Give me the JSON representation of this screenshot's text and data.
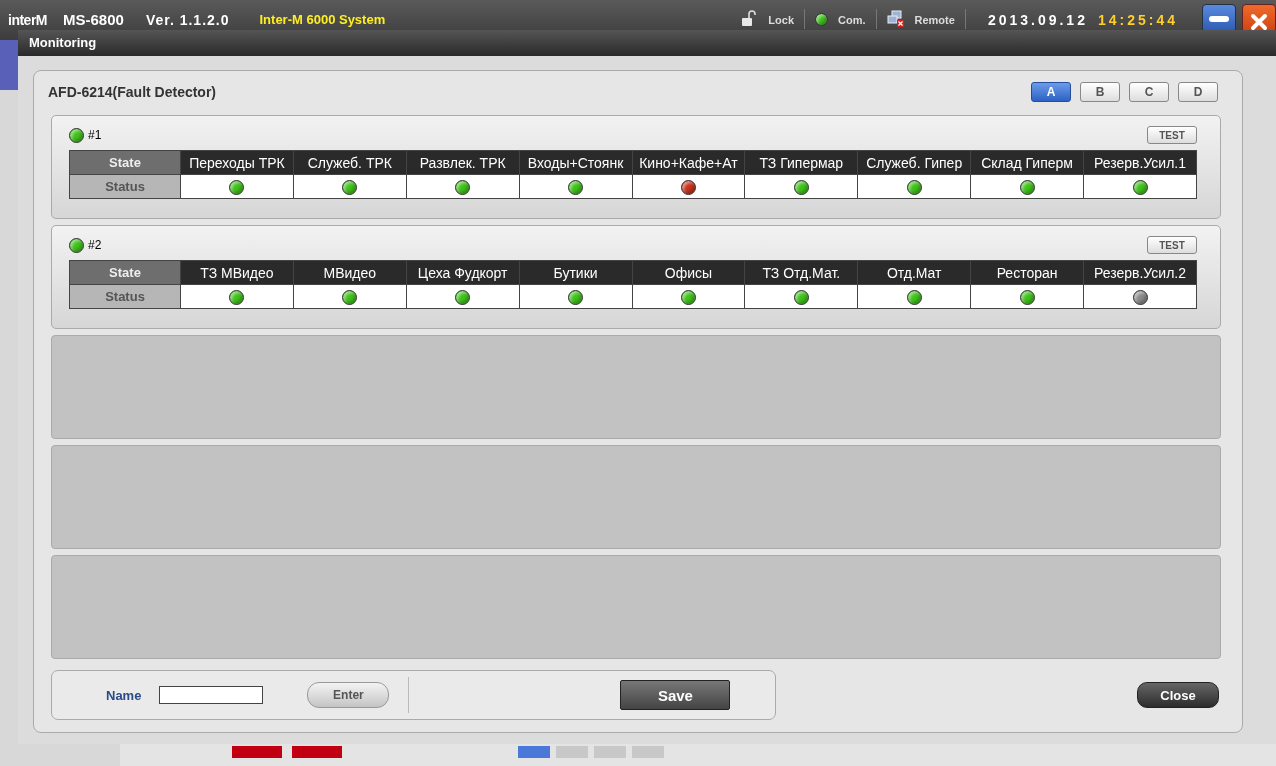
{
  "topbar": {
    "logo": "interM",
    "model": "MS-6800",
    "version": "Ver. 1.1.2.0",
    "system": "Inter-M 6000 System",
    "indicators": [
      {
        "kind": "lock",
        "label": "Lock"
      },
      {
        "kind": "led",
        "label": "Com.",
        "on": true
      },
      {
        "kind": "remote",
        "label": "Remote"
      }
    ],
    "date": "2013.09.12",
    "time": "14:25:44"
  },
  "dialog": {
    "title": "Monitoring",
    "device": "AFD-6214(Fault Detector)",
    "pages": [
      {
        "label": "A",
        "selected": true
      },
      {
        "label": "B",
        "selected": false
      },
      {
        "label": "C",
        "selected": false
      },
      {
        "label": "D",
        "selected": false
      }
    ],
    "groups": [
      {
        "label": "#1",
        "on": true,
        "test": "TEST",
        "row_headers": [
          "State",
          "Status"
        ],
        "channels": [
          {
            "name": "Переходы ТРК",
            "color": "#3fc21a"
          },
          {
            "name": "Служеб. ТРК",
            "color": "#3fc21a"
          },
          {
            "name": "Развлек. ТРК",
            "color": "#3fc21a"
          },
          {
            "name": "Входы+Стоянк",
            "color": "#3fc21a"
          },
          {
            "name": "Кино+Кафе+Ат",
            "color": "#c8321a"
          },
          {
            "name": "ТЗ Гипермар",
            "color": "#3fc21a"
          },
          {
            "name": "Служеб. Гипер",
            "color": "#3fc21a"
          },
          {
            "name": "Склад Гиперм",
            "color": "#3fc21a"
          },
          {
            "name": "Резерв.Усил.1",
            "color": "#3fc21a"
          }
        ]
      },
      {
        "label": "#2",
        "on": true,
        "test": "TEST",
        "row_headers": [
          "State",
          "Status"
        ],
        "channels": [
          {
            "name": "ТЗ МВидео",
            "color": "#3fc21a"
          },
          {
            "name": "МВидео",
            "color": "#3fc21a"
          },
          {
            "name": "Цеха Фудкорт",
            "color": "#3fc21a"
          },
          {
            "name": "Бутики",
            "color": "#3fc21a"
          },
          {
            "name": "Офисы",
            "color": "#3fc21a"
          },
          {
            "name": "ТЗ Отд.Мат.",
            "color": "#3fc21a"
          },
          {
            "name": "Отд.Мат",
            "color": "#3fc21a"
          },
          {
            "name": "Ресторан",
            "color": "#3fc21a"
          },
          {
            "name": "Резерв.Усил.2",
            "color": "#8a8a8a"
          }
        ]
      },
      {
        "kind": "empty"
      },
      {
        "kind": "empty"
      },
      {
        "kind": "empty"
      }
    ],
    "footer": {
      "name_label": "Name",
      "enter": "Enter",
      "save": "Save",
      "close": "Close"
    }
  }
}
